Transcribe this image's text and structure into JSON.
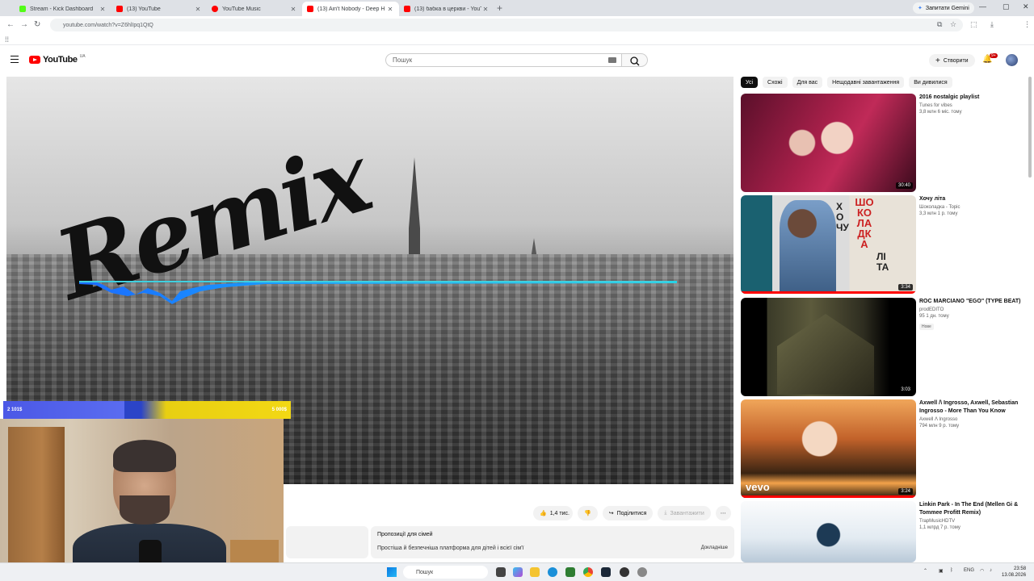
{
  "browser": {
    "tabs": [
      {
        "title": "Stream - Kick Dashboard",
        "color": "#53fc18",
        "active": false
      },
      {
        "title": "(13) YouTube",
        "color": "#ff0000",
        "active": false
      },
      {
        "title": "YouTube Music",
        "color": "#ff0000",
        "active": false
      },
      {
        "title": "(13) Ain't Nobody - Deep H",
        "color": "#ff0000",
        "active": true
      },
      {
        "title": "(13) бабка в церкви - YouTube",
        "color": "#ff0000",
        "active": false
      }
    ],
    "new_tab": "+",
    "gemini_label": "Запитати Gemini",
    "url": "youtube.com/watch?v=Z6hlIpq1QtQ"
  },
  "youtube": {
    "logo_text": "YouTube",
    "region": "UA",
    "search_placeholder": "Пошук",
    "create_label": "Створити",
    "notification_count": "9+"
  },
  "player": {
    "overlay_text": "Remix",
    "bar_left": "2 101$",
    "bar_right": "5 000$"
  },
  "actions": {
    "like_count": "1,4 тис.",
    "share_label": "Поділитися",
    "download_label": "Завантажити"
  },
  "description": {
    "title": "Пропозиції для сімей",
    "text": "Простіша й безпечніша платформа для дітей і всієї сім'ї",
    "more": "Докладніше"
  },
  "sidebar": {
    "chips": [
      "Усі",
      "Схожі",
      "Для вас",
      "Нещодавні завантаження",
      "Ви дивилися"
    ],
    "videos": [
      {
        "title": "2016 nostalgic playlist",
        "channel": "Tunes for vibes",
        "stats": "3,8 млн  6 міс. тому",
        "duration": "30:40",
        "badge": ""
      },
      {
        "title": "Хочу літа",
        "channel": "Шоколадка - Topic",
        "stats": "3,3 млн  1 р. тому",
        "duration": "3:34",
        "badge": ""
      },
      {
        "title": "ROC MARCIANO \"EGO\" (TYPE BEAT)",
        "channel": "prodEDITO",
        "stats": "95  1 дн. тому",
        "duration": "3:03",
        "badge": "Нове"
      },
      {
        "title": "Axwell /\\ Ingrosso, Axwell, Sebastian Ingrosso - More Than You Know",
        "channel": "Axwell Λ Ingrosso",
        "stats": "794 млн  9 р. тому",
        "duration": "3:24",
        "badge": ""
      },
      {
        "title": "Linkin Park - In The End (Mellen Gi & Tommee Profitt Remix)",
        "channel": "TrapMusicHDTV",
        "stats": "1,1 млрд  7 р. тому",
        "duration": "",
        "badge": ""
      }
    ],
    "vevo": "vevo",
    "album_text": "ШОКОЛАДКА",
    "album_side": "ХОЧУ",
    "album_side2": "ЛІТА"
  },
  "taskbar": {
    "search_placeholder": "Пошук",
    "lang": "ENG",
    "time": "23:58",
    "date": "13.08.2026"
  }
}
